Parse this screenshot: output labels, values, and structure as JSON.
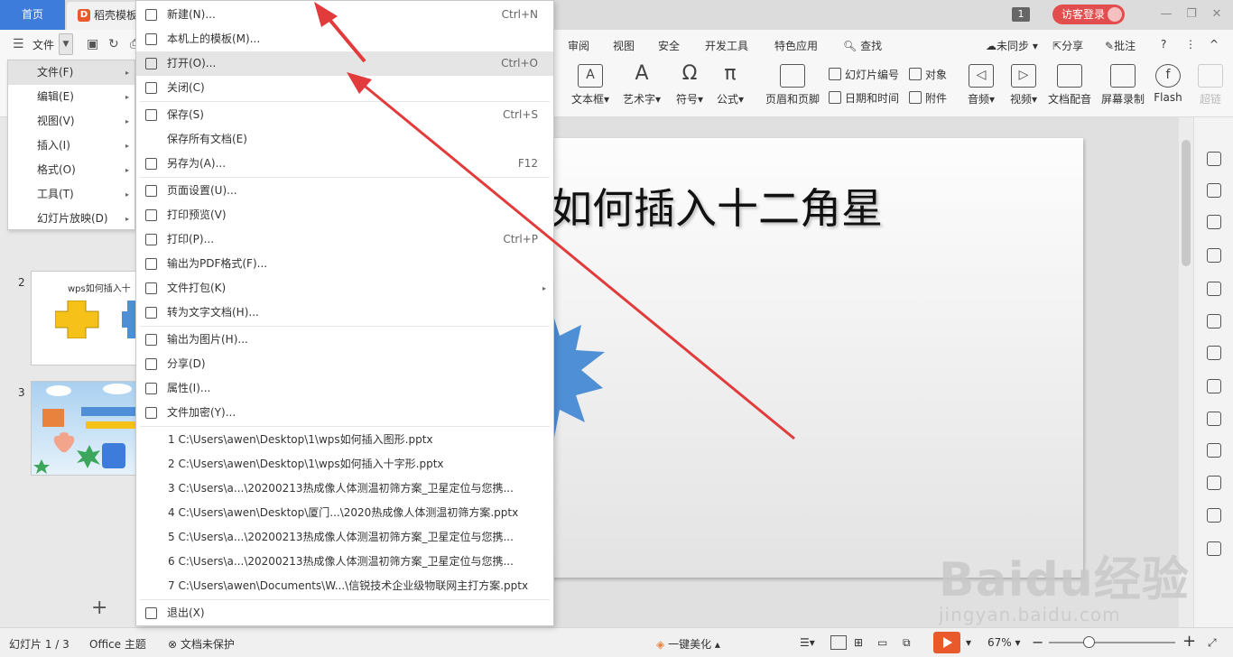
{
  "titlebar": {
    "home_tab": "首页",
    "doc_tab": "稻壳模板",
    "window_count": "1",
    "login": "访客登录",
    "minimize": "—",
    "restore": "❐",
    "close": "✕"
  },
  "menubar": {
    "file": "文件",
    "tabs": [
      "审阅",
      "视图",
      "安全",
      "开发工具",
      "特色应用"
    ],
    "search": "查找",
    "sync": "未同步",
    "share": "分享",
    "comment": "批注",
    "help": "?",
    "more": "⋮",
    "collapse": "^"
  },
  "ribbon": {
    "textbox": "文本框",
    "arttext": "艺术字",
    "symbol": "符号",
    "formula": "公式",
    "header_footer": "页眉和页脚",
    "slide_number": "幻灯片编号",
    "object": "对象",
    "datetime": "日期和时间",
    "attachment": "附件",
    "audio": "音频",
    "video": "视频",
    "doc_voice": "文档配音",
    "screen_record": "屏幕录制",
    "flash": "Flash",
    "super": "超链"
  },
  "side_menu": [
    {
      "label": "文件(F)"
    },
    {
      "label": "编辑(E)"
    },
    {
      "label": "视图(V)"
    },
    {
      "label": "插入(I)"
    },
    {
      "label": "格式(O)"
    },
    {
      "label": "工具(T)"
    },
    {
      "label": "幻灯片放映(D)"
    }
  ],
  "file_menu": {
    "items": [
      {
        "label": "新建(N)...",
        "shortcut": "Ctrl+N"
      },
      {
        "label": "本机上的模板(M)...",
        "shortcut": ""
      },
      {
        "label": "打开(O)...",
        "shortcut": "Ctrl+O"
      },
      {
        "label": "关闭(C)",
        "shortcut": ""
      },
      {
        "label": "保存(S)",
        "shortcut": "Ctrl+S"
      },
      {
        "label": "保存所有文档(E)",
        "shortcut": ""
      },
      {
        "label": "另存为(A)...",
        "shortcut": "F12"
      },
      {
        "label": "页面设置(U)...",
        "shortcut": ""
      },
      {
        "label": "打印预览(V)",
        "shortcut": ""
      },
      {
        "label": "打印(P)...",
        "shortcut": "Ctrl+P"
      },
      {
        "label": "输出为PDF格式(F)...",
        "shortcut": ""
      },
      {
        "label": "文件打包(K)",
        "shortcut": ""
      },
      {
        "label": "转为文字文档(H)...",
        "shortcut": ""
      },
      {
        "label": "输出为图片(H)...",
        "shortcut": ""
      },
      {
        "label": "分享(D)",
        "shortcut": ""
      },
      {
        "label": "属性(I)...",
        "shortcut": ""
      },
      {
        "label": "文件加密(Y)...",
        "shortcut": ""
      },
      {
        "label": "退出(X)",
        "shortcut": ""
      }
    ],
    "recent": [
      "1 C:\\Users\\awen\\Desktop\\1\\wps如何插入图形.pptx",
      "2 C:\\Users\\awen\\Desktop\\1\\wps如何插入十字形.pptx",
      "3 C:\\Users\\a...\\20200213热成像人体测温初筛方案_卫星定位与您携...",
      "4 C:\\Users\\awen\\Desktop\\厦门...\\2020热成像人体测温初筛方案.pptx",
      "5 C:\\Users\\a...\\20200213热成像人体测温初筛方案_卫星定位与您携...",
      "6 C:\\Users\\a...\\20200213热成像人体测温初筛方案_卫星定位与您携...",
      "7 C:\\Users\\awen\\Documents\\W...\\信锐技术企业级物联网主打方案.pptx"
    ]
  },
  "slides": {
    "numbers": [
      "2",
      "3"
    ],
    "slide2_title": "wps如何插入十",
    "add": "+"
  },
  "canvas": {
    "title": "如何插入十二角星"
  },
  "statusbar": {
    "slide_info": "幻灯片 1 / 3",
    "theme": "Office 主题",
    "protect": "文档未保护",
    "beautify": "一键美化",
    "zoom": "67%",
    "minus": "−",
    "plus": "+"
  },
  "watermark": {
    "logo": "Baidu经验",
    "url": "jingyan.baidu.com"
  },
  "colors": {
    "accent": "#3d7cdb",
    "play": "#e85a2b",
    "login": "#e24e4e",
    "star": "#4f8fd6",
    "arrow": "#e23b3b"
  }
}
